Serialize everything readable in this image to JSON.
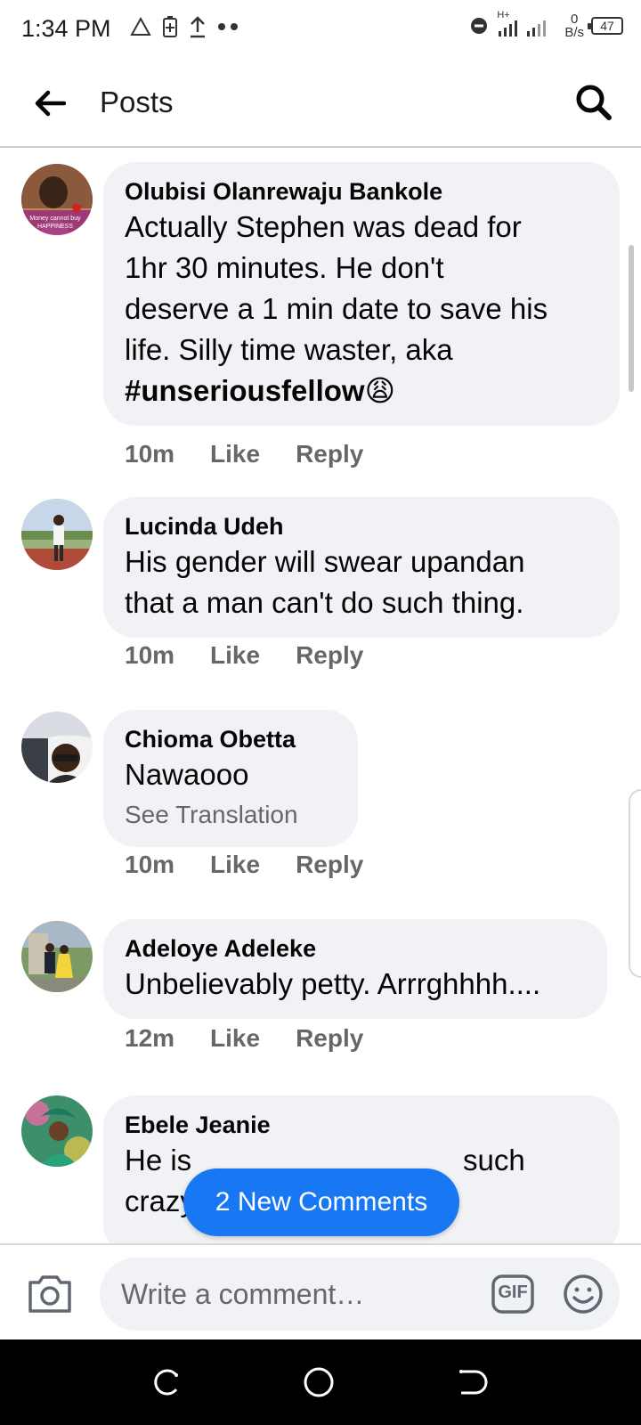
{
  "status_bar": {
    "time": "1:34 PM",
    "net_speed_value": "0",
    "net_speed_unit": "B/s",
    "battery": "47",
    "network_label": "H+"
  },
  "header": {
    "title": "Posts"
  },
  "comments": [
    {
      "author": "Olubisi Olanrewaju Bankole",
      "text_lines": [
        "Actually  Stephen was dead for",
        "1hr 30 minutes. He don't",
        "deserve a 1 min date to save his",
        "life. Silly time waster, aka"
      ],
      "hashtag": "#unseriousfellow",
      "emoji": "😩",
      "avatar_caption_1": "Money cannot buy",
      "avatar_caption_2": "HAPPINESS",
      "time": "10m",
      "like": "Like",
      "reply": "Reply"
    },
    {
      "author": "Lucinda Udeh",
      "text_lines": [
        "His gender will swear upandan",
        "that a man can't do such thing."
      ],
      "time": "10m",
      "like": "Like",
      "reply": "Reply"
    },
    {
      "author": "Chioma Obetta",
      "text_lines": [
        "Nawaooo"
      ],
      "see_translation": "See Translation",
      "time": "10m",
      "like": "Like",
      "reply": "Reply"
    },
    {
      "author": "Adeloye Adeleke",
      "text_lines": [
        "Unbelievably petty. Arrrghhhh...."
      ],
      "time": "12m",
      "like": "Like",
      "reply": "Reply"
    },
    {
      "author": "Ebele Jeanie",
      "text_visible_left": "He is",
      "text_visible_right": "such",
      "text_line2": "crazy men"
    }
  ],
  "new_comments_pill": "2 New Comments",
  "composer": {
    "placeholder": "Write a comment…",
    "gif_label": "GIF"
  },
  "colors": {
    "accent": "#1877f2",
    "bubble": "#f0f2f5",
    "meta_text": "#65676b"
  }
}
